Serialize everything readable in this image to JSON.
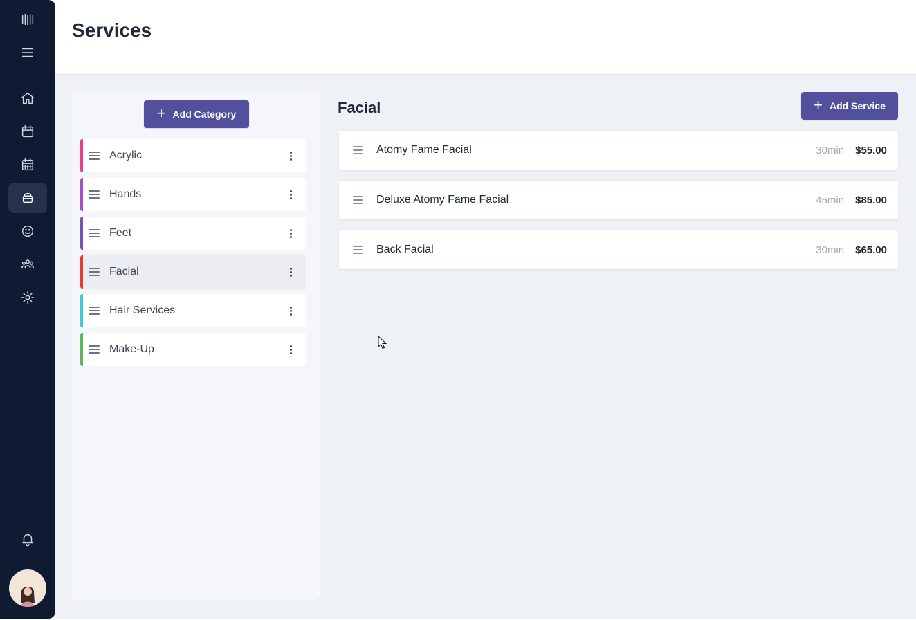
{
  "header": {
    "title": "Services"
  },
  "sidebar": {
    "items": [
      {
        "name": "logo-icon"
      },
      {
        "name": "menu-icon"
      },
      {
        "name": "home-icon"
      },
      {
        "name": "calendar-icon"
      },
      {
        "name": "calendar-grid-icon"
      },
      {
        "name": "services-icon",
        "active": true
      },
      {
        "name": "smiley-icon"
      },
      {
        "name": "team-icon"
      },
      {
        "name": "gear-icon"
      },
      {
        "name": "bell-icon"
      }
    ]
  },
  "categories": {
    "add_label": "Add Category",
    "items": [
      {
        "label": "Acrylic",
        "color": "#e83e8c"
      },
      {
        "label": "Hands",
        "color": "#a84fc7"
      },
      {
        "label": "Feet",
        "color": "#7952b3"
      },
      {
        "label": "Facial",
        "color": "#e53935",
        "selected": true
      },
      {
        "label": "Hair Services",
        "color": "#3bc6d9"
      },
      {
        "label": "Make-Up",
        "color": "#5cb85c"
      }
    ]
  },
  "services": {
    "title": "Facial",
    "add_label": "Add Service",
    "items": [
      {
        "name": "Atomy Fame Facial",
        "duration": "30min",
        "price": "$55.00"
      },
      {
        "name": "Deluxe Atomy Fame Facial",
        "duration": "45min",
        "price": "$85.00"
      },
      {
        "name": "Back Facial",
        "duration": "30min",
        "price": "$65.00"
      }
    ]
  },
  "theme": {
    "accent": "#524f9c",
    "sidebar_bg": "#0f1a33"
  }
}
